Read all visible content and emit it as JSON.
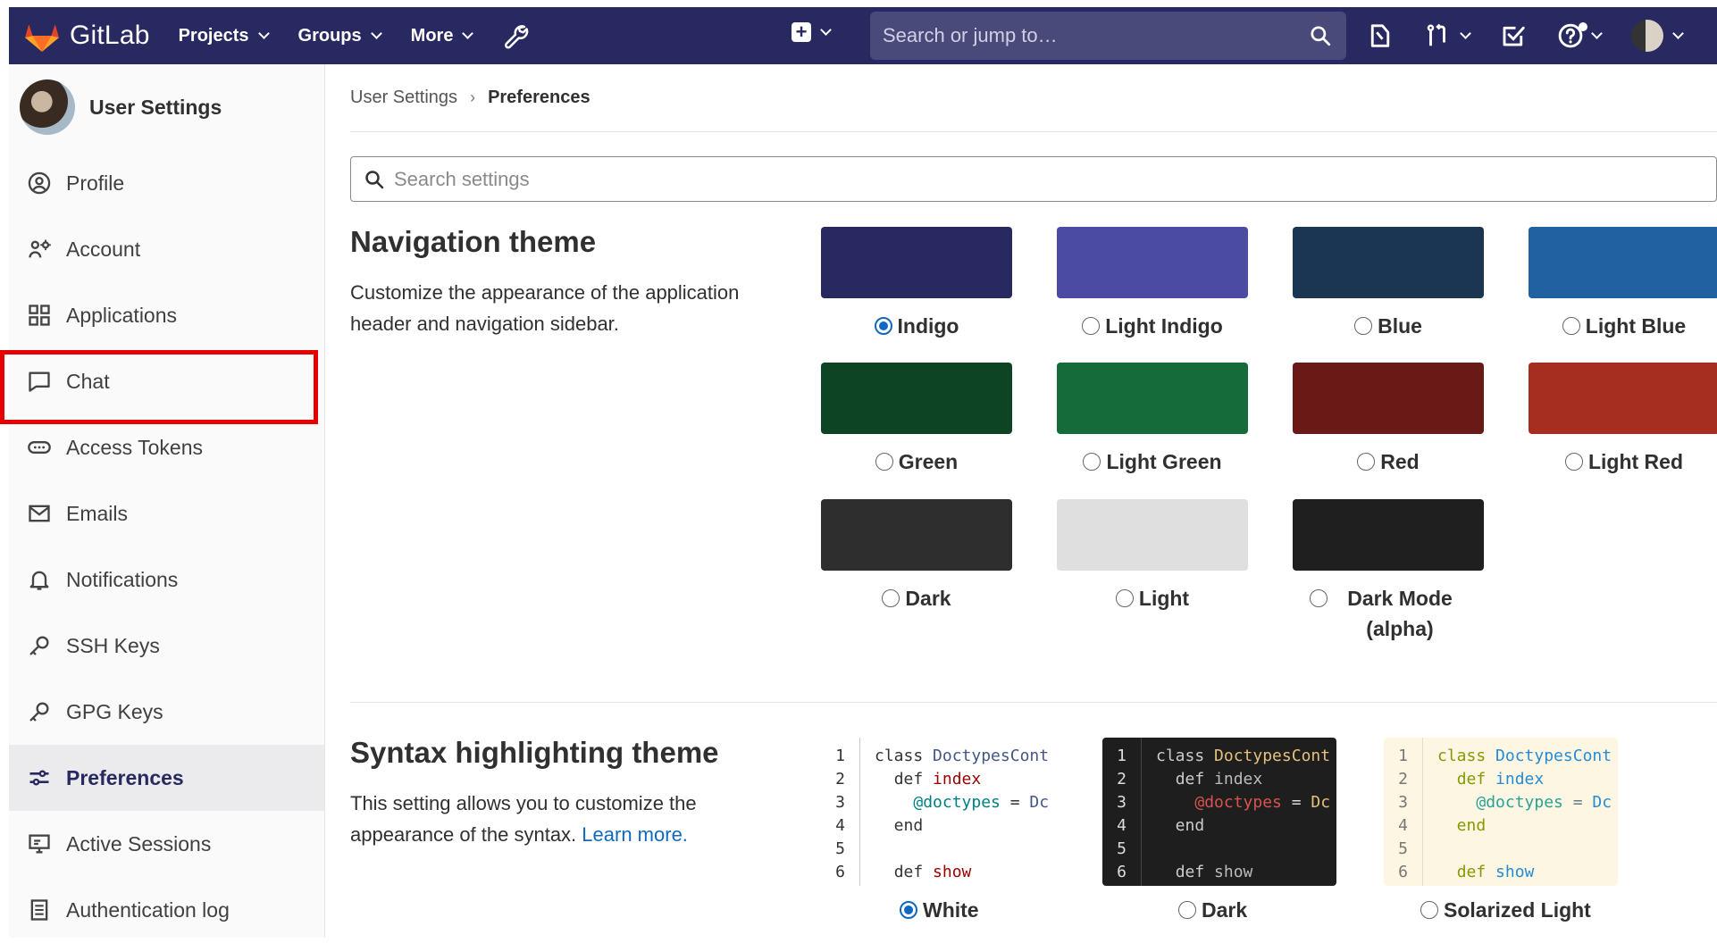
{
  "header": {
    "logo_text": "GitLab",
    "nav": [
      {
        "label": "Projects"
      },
      {
        "label": "Groups"
      },
      {
        "label": "More"
      }
    ],
    "search_placeholder": "Search or jump to…",
    "colors": {
      "bar": "#292961"
    }
  },
  "sidebar": {
    "title": "User Settings",
    "items": [
      {
        "label": "Profile",
        "icon": "profile-icon"
      },
      {
        "label": "Account",
        "icon": "account-icon"
      },
      {
        "label": "Applications",
        "icon": "applications-icon"
      },
      {
        "label": "Chat",
        "icon": "chat-icon"
      },
      {
        "label": "Access Tokens",
        "icon": "token-icon"
      },
      {
        "label": "Emails",
        "icon": "mail-icon"
      },
      {
        "label": "Notifications",
        "icon": "bell-icon"
      },
      {
        "label": "SSH Keys",
        "icon": "key-icon"
      },
      {
        "label": "GPG Keys",
        "icon": "key-icon"
      },
      {
        "label": "Preferences",
        "icon": "preferences-icon"
      },
      {
        "label": "Active Sessions",
        "icon": "monitor-icon"
      },
      {
        "label": "Authentication log",
        "icon": "log-icon"
      }
    ],
    "active_item": "Preferences",
    "highlighted_item": "Access Tokens"
  },
  "breadcrumb": {
    "parent": "User Settings",
    "current": "Preferences"
  },
  "settings_search_placeholder": "Search settings",
  "navigation_theme": {
    "title": "Navigation theme",
    "description": "Customize the appearance of the application header and navigation sidebar.",
    "options": [
      {
        "label": "Indigo",
        "color": "#292961",
        "checked": true
      },
      {
        "label": "Light Indigo",
        "color": "#4b4ba3",
        "checked": false
      },
      {
        "label": "Blue",
        "color": "#1a3652",
        "checked": false
      },
      {
        "label": "Light Blue",
        "color": "#2261a1",
        "checked": false
      },
      {
        "label": "Green",
        "color": "#0d4524",
        "checked": false
      },
      {
        "label": "Light Green",
        "color": "#156b39",
        "checked": false
      },
      {
        "label": "Red",
        "color": "#691a16",
        "checked": false
      },
      {
        "label": "Light Red",
        "color": "#a62e21",
        "checked": false
      },
      {
        "label": "Dark",
        "color": "#2e2e2e",
        "checked": false
      },
      {
        "label": "Light",
        "color": "#dfdfdf",
        "checked": false
      },
      {
        "label": "Dark Mode (alpha)",
        "color": "#1f1f1f",
        "checked": false
      }
    ]
  },
  "syntax_theme": {
    "title": "Syntax highlighting theme",
    "description": "This setting allows you to customize the appearance of the syntax.",
    "learn_more": "Learn more.",
    "line_numbers": [
      "1",
      "2",
      "3",
      "4",
      "5",
      "6"
    ],
    "code_lines": [
      "class DoctypesCont",
      "  def index",
      "    @doctypes = Dc",
      "  end",
      "",
      "  def show"
    ],
    "options": [
      {
        "label": "White",
        "checked": true
      },
      {
        "label": "Dark",
        "checked": false
      },
      {
        "label": "Solarized Light",
        "checked": false
      }
    ]
  }
}
